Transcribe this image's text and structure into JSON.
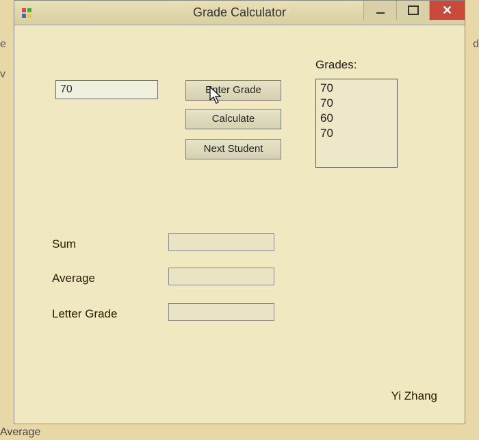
{
  "window": {
    "title": "Grade Calculator"
  },
  "input": {
    "value": "70"
  },
  "buttons": {
    "enter": "Enter Grade",
    "calculate": "Calculate",
    "next": "Next Student"
  },
  "grades": {
    "label": "Grades:",
    "items": [
      "70",
      "70",
      "60",
      "70"
    ]
  },
  "results": {
    "sum_label": "Sum",
    "sum_value": "",
    "average_label": "Average",
    "average_value": "",
    "letter_label": "Letter Grade",
    "letter_value": ""
  },
  "author": "Yi Zhang",
  "background_fragments": {
    "e": "e",
    "v": "v",
    "d": "d",
    "average": "Average"
  }
}
